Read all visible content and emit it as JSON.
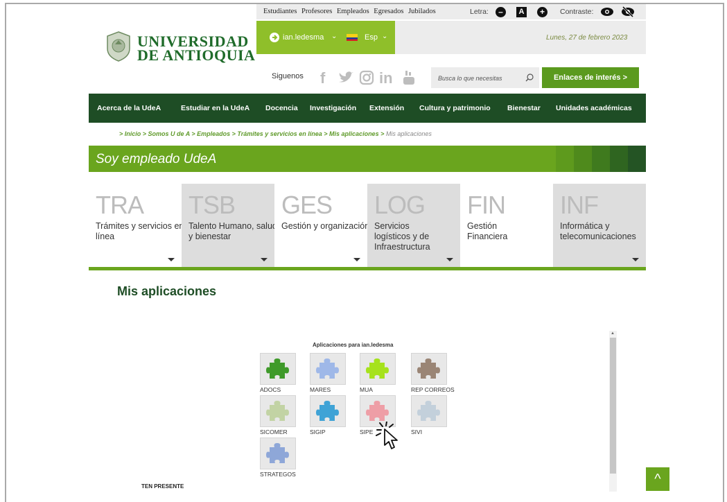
{
  "top_links": [
    "Estudiantes",
    "Profesores",
    "Empleados",
    "Egresados",
    "Jubilados"
  ],
  "letra": {
    "label": "Letra:",
    "decrease": "–",
    "normal": "A",
    "increase": "+"
  },
  "contraste": {
    "label": "Contraste:"
  },
  "brand": {
    "line1": "UNIVERSIDAD",
    "line2": "DE ANTIOQUIA"
  },
  "user": {
    "name": "ian.ledesma",
    "language": "Esp"
  },
  "date": "Lunes, 27 de febrero 2023",
  "social": {
    "label": "Siguenos"
  },
  "search": {
    "placeholder": "Busca lo que necesitas"
  },
  "enlaces": "Enlaces de interés",
  "nav": [
    "Acerca de la UdeA",
    "Estudiar en la UdeA",
    "Docencia",
    "Investigación",
    "Extensión",
    "Cultura y patrimonio",
    "Bienestar",
    "Unidades académicas"
  ],
  "breadcrumb": {
    "links": "> Inicio > Somos U de A > Empleados > Trámites y servicios en línea > Mis aplicaciones >",
    "current": "Mis aplicaciones"
  },
  "banner_title": "Soy empleado UdeA",
  "tiles": [
    {
      "code": "TRA",
      "label": "Trámites y servicios en línea"
    },
    {
      "code": "TSB",
      "label": "Talento Humano, salud y bienestar"
    },
    {
      "code": "GES",
      "label": "Gestión y organización"
    },
    {
      "code": "LOG",
      "label": "Servicios logísticos y de Infraestructura"
    },
    {
      "code": "FIN",
      "label": "Gestión Financiera"
    },
    {
      "code": "INF",
      "label": "Informática y telecomunicaciones"
    }
  ],
  "section_title": "Mis aplicaciones",
  "apps_title": "Aplicaciones para ian.ledesma",
  "apps": [
    {
      "label": "ADOCS",
      "color": "#3f9a2a"
    },
    {
      "label": "MARES",
      "color": "#9fb8e8"
    },
    {
      "label": "MUA",
      "color": "#a6e21c"
    },
    {
      "label": "REP CORREOS",
      "color": "#9a8575"
    },
    {
      "label": "SICOMER",
      "color": "#c2d3a4"
    },
    {
      "label": "SIGIP",
      "color": "#3fa3d6"
    },
    {
      "label": "SIPE",
      "color": "#ee9ea6"
    },
    {
      "label": "SIVI",
      "color": "#c3d0db"
    },
    {
      "label": "STRATEGOS",
      "color": "#8ea7d8"
    }
  ],
  "ten_presente": "TEN PRESENTE",
  "to_top": "^"
}
